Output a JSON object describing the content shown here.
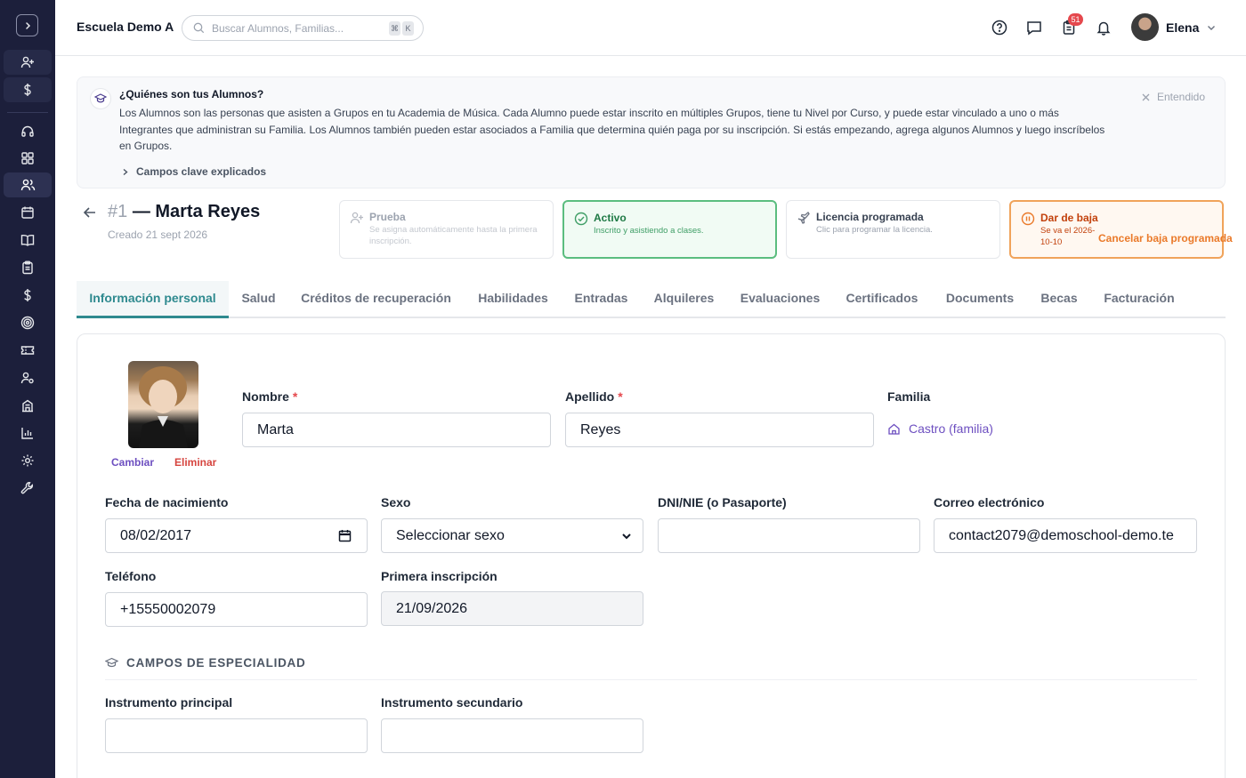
{
  "header": {
    "school_name": "Escuela Demo A",
    "search_placeholder": "Buscar Alumnos, Familias...",
    "kbd_1": "⌘",
    "kbd_2": "K",
    "notification_count": "51",
    "user_name": "Elena"
  },
  "sidebar": {
    "icons": [
      "chevron-right-icon",
      "user-plus-icon",
      "dollar-icon",
      "headset-icon",
      "grid-icon",
      "users-icon",
      "calendar-icon",
      "book-icon",
      "clipboard-icon",
      "dollar-icon",
      "target-icon",
      "ticket-icon",
      "user-cog-icon",
      "building-icon",
      "bar-chart-icon",
      "gear-icon",
      "wrench-icon"
    ],
    "active": "users-icon"
  },
  "banner": {
    "title": "¿Quiénes son tus Alumnos?",
    "text": "Los Alumnos son las personas que asisten a Grupos en tu Academia de Música. Cada Alumno puede estar inscrito en múltiples Grupos, tiene tu Nivel por Curso, y puede estar vinculado a uno o más Integrantes que administran su Familia. Los Alumnos también pueden estar asociados a Familia que determina quién paga por su inscripción. Si estás empezando, agrega algunos Alumnos y luego inscríbelos en Grupos.",
    "link": "Campos clave explicados",
    "dismiss": "Entendido"
  },
  "student": {
    "number": "#1",
    "title": "— Marta Reyes",
    "created": "Creado 21 sept 2026"
  },
  "statuses": [
    {
      "title": "Prueba",
      "desc": "Se asigna automáticamente hasta la primera inscripción.",
      "state": "disabled"
    },
    {
      "title": "Activo",
      "desc": "Inscrito y asistiendo a clases.",
      "state": "active"
    },
    {
      "title": "Licencia programada",
      "desc": "Clic para programar la licencia.",
      "state": "normal"
    },
    {
      "title": "Dar de baja",
      "desc": "Se va el 2026-10-10",
      "state": "leave",
      "action": "Cancelar baja programada"
    }
  ],
  "tabs": [
    "Información personal",
    "Salud",
    "Créditos de recuperación",
    "Habilidades",
    "Entradas",
    "Alquileres",
    "Evaluaciones",
    "Certificados",
    "Documents",
    "Becas",
    "Facturación"
  ],
  "active_tab": "Información personal",
  "form": {
    "photo_change": "Cambiar",
    "photo_delete": "Eliminar",
    "first_name_label": "Nombre",
    "first_name": "Marta",
    "last_name_label": "Apellido",
    "last_name": "Reyes",
    "family_label": "Familia",
    "family_value": "Castro (familia)",
    "birth_label": "Fecha de nacimiento",
    "birth_value": "08/02/2017",
    "sex_label": "Sexo",
    "sex_value": "Seleccionar sexo",
    "id_label": "DNI/NIE (o Pasaporte)",
    "id_value": "",
    "email_label": "Correo electrónico",
    "email_value": "contact2079@demoschool-demo.te",
    "phone_label": "Teléfono",
    "phone_value": "+15550002079",
    "first_enroll_label": "Primera inscripción",
    "first_enroll_value": "21/09/2026",
    "section_title": "CAMPOS DE ESPECIALIDAD",
    "instr1_label": "Instrumento principal",
    "instr1_value": "",
    "instr2_label": "Instrumento secundario",
    "instr2_value": "",
    "required_mark": "*"
  },
  "colors": {
    "sidebar_bg": "#1c1f3b",
    "accent_teal": "#2f8a8f",
    "link_purple": "#6d4fc0",
    "active_green": "#5bbd7f",
    "leave_orange": "#f0a35a",
    "danger_red": "#e5484d"
  }
}
